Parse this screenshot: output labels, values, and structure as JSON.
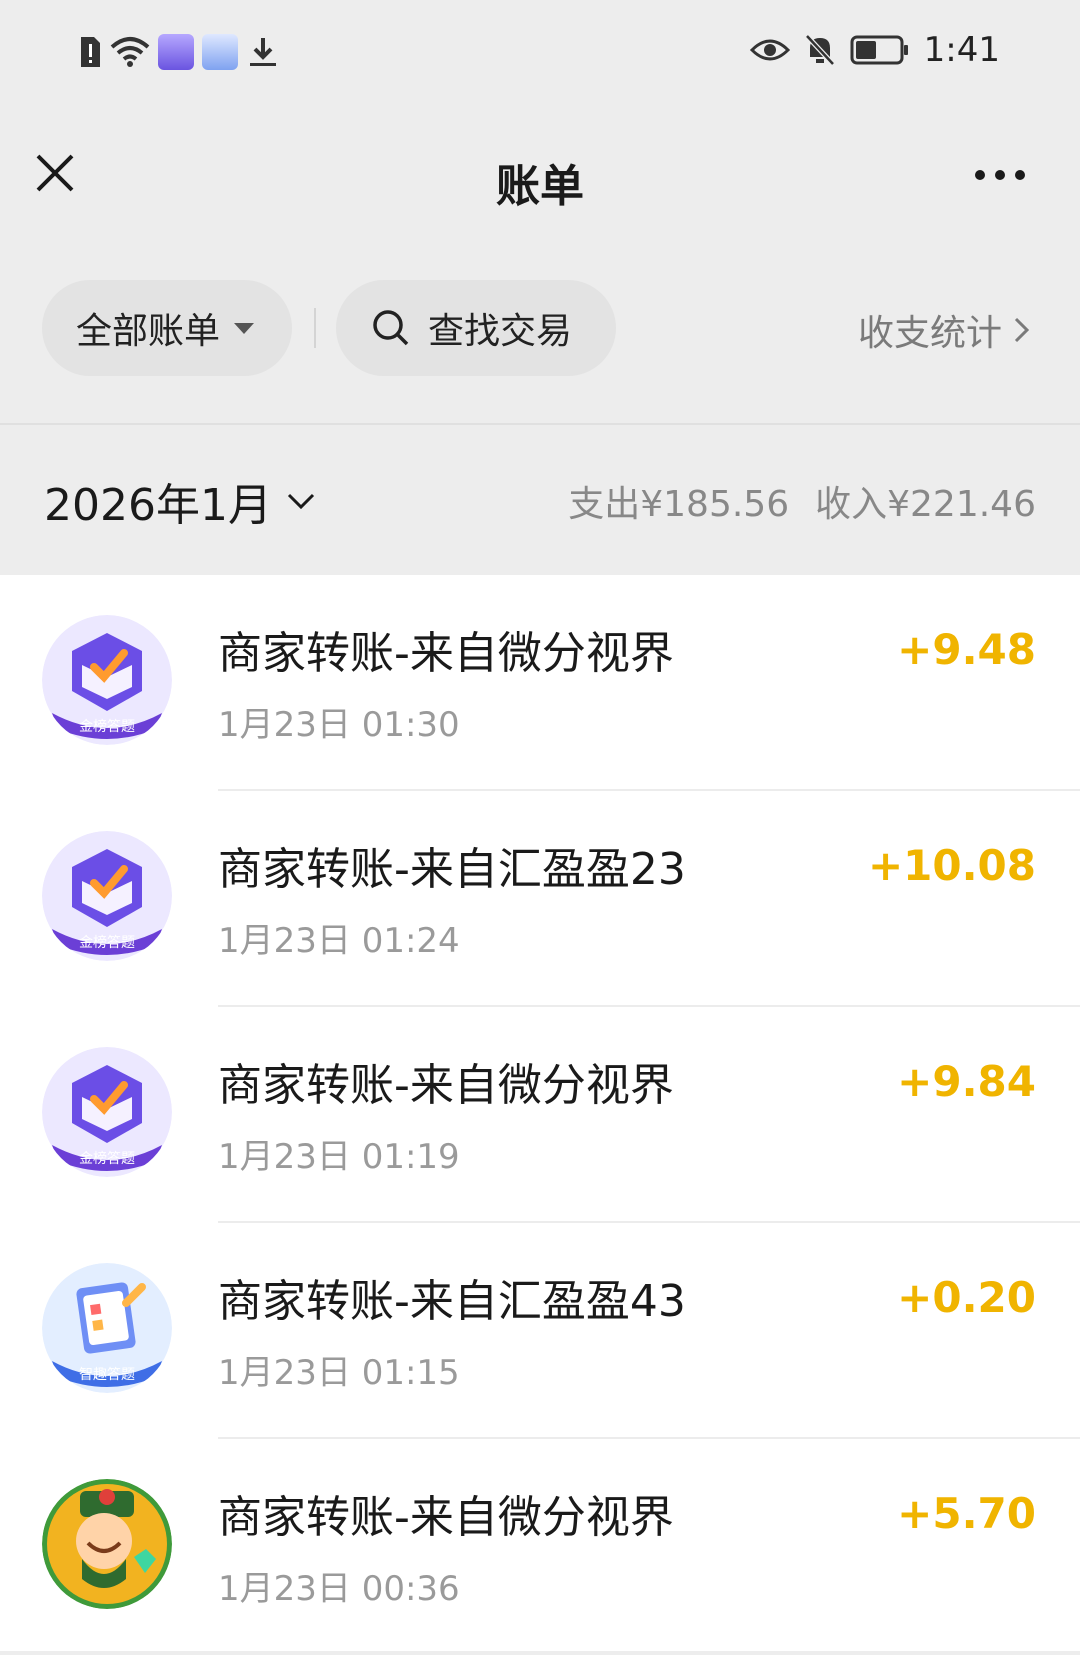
{
  "status_bar": {
    "time": "1:41",
    "icons": [
      "sim-alert-icon",
      "wifi-icon",
      "app-notification-icon",
      "app-notification-icon",
      "download-icon",
      "eye-icon",
      "bell-off-icon",
      "battery-icon"
    ]
  },
  "nav": {
    "title": "账单",
    "close_icon": "close-icon",
    "more_icon": "more-icon"
  },
  "filters": {
    "all_bills_label": "全部账单",
    "search_label": "查找交易",
    "stats_label": "收支统计"
  },
  "month": {
    "label": "2026年1月",
    "expense_label": "支出¥185.56",
    "income_label": "收入¥221.46"
  },
  "transactions": [
    {
      "title": "商家转账-来自微分视界",
      "time": "1月23日 01:30",
      "amount": "+9.48",
      "avatar": "gold-quiz-icon"
    },
    {
      "title": "商家转账-来自汇盈盈23",
      "time": "1月23日 01:24",
      "amount": "+10.08",
      "avatar": "gold-quiz-icon"
    },
    {
      "title": "商家转账-来自微分视界",
      "time": "1月23日 01:19",
      "amount": "+9.84",
      "avatar": "gold-quiz-icon"
    },
    {
      "title": "商家转账-来自汇盈盈43",
      "time": "1月23日 01:15",
      "amount": "+0.20",
      "avatar": "smart-quiz-icon"
    },
    {
      "title": "商家转账-来自微分视界",
      "time": "1月23日 00:36",
      "amount": "+5.70",
      "avatar": "fortune-god-icon"
    }
  ],
  "avatar_badges": {
    "gold": "金榜答题",
    "smart": "智趣答题"
  },
  "colors": {
    "amount": "#f0b400",
    "background": "#ededed",
    "list_bg": "#ffffff"
  }
}
